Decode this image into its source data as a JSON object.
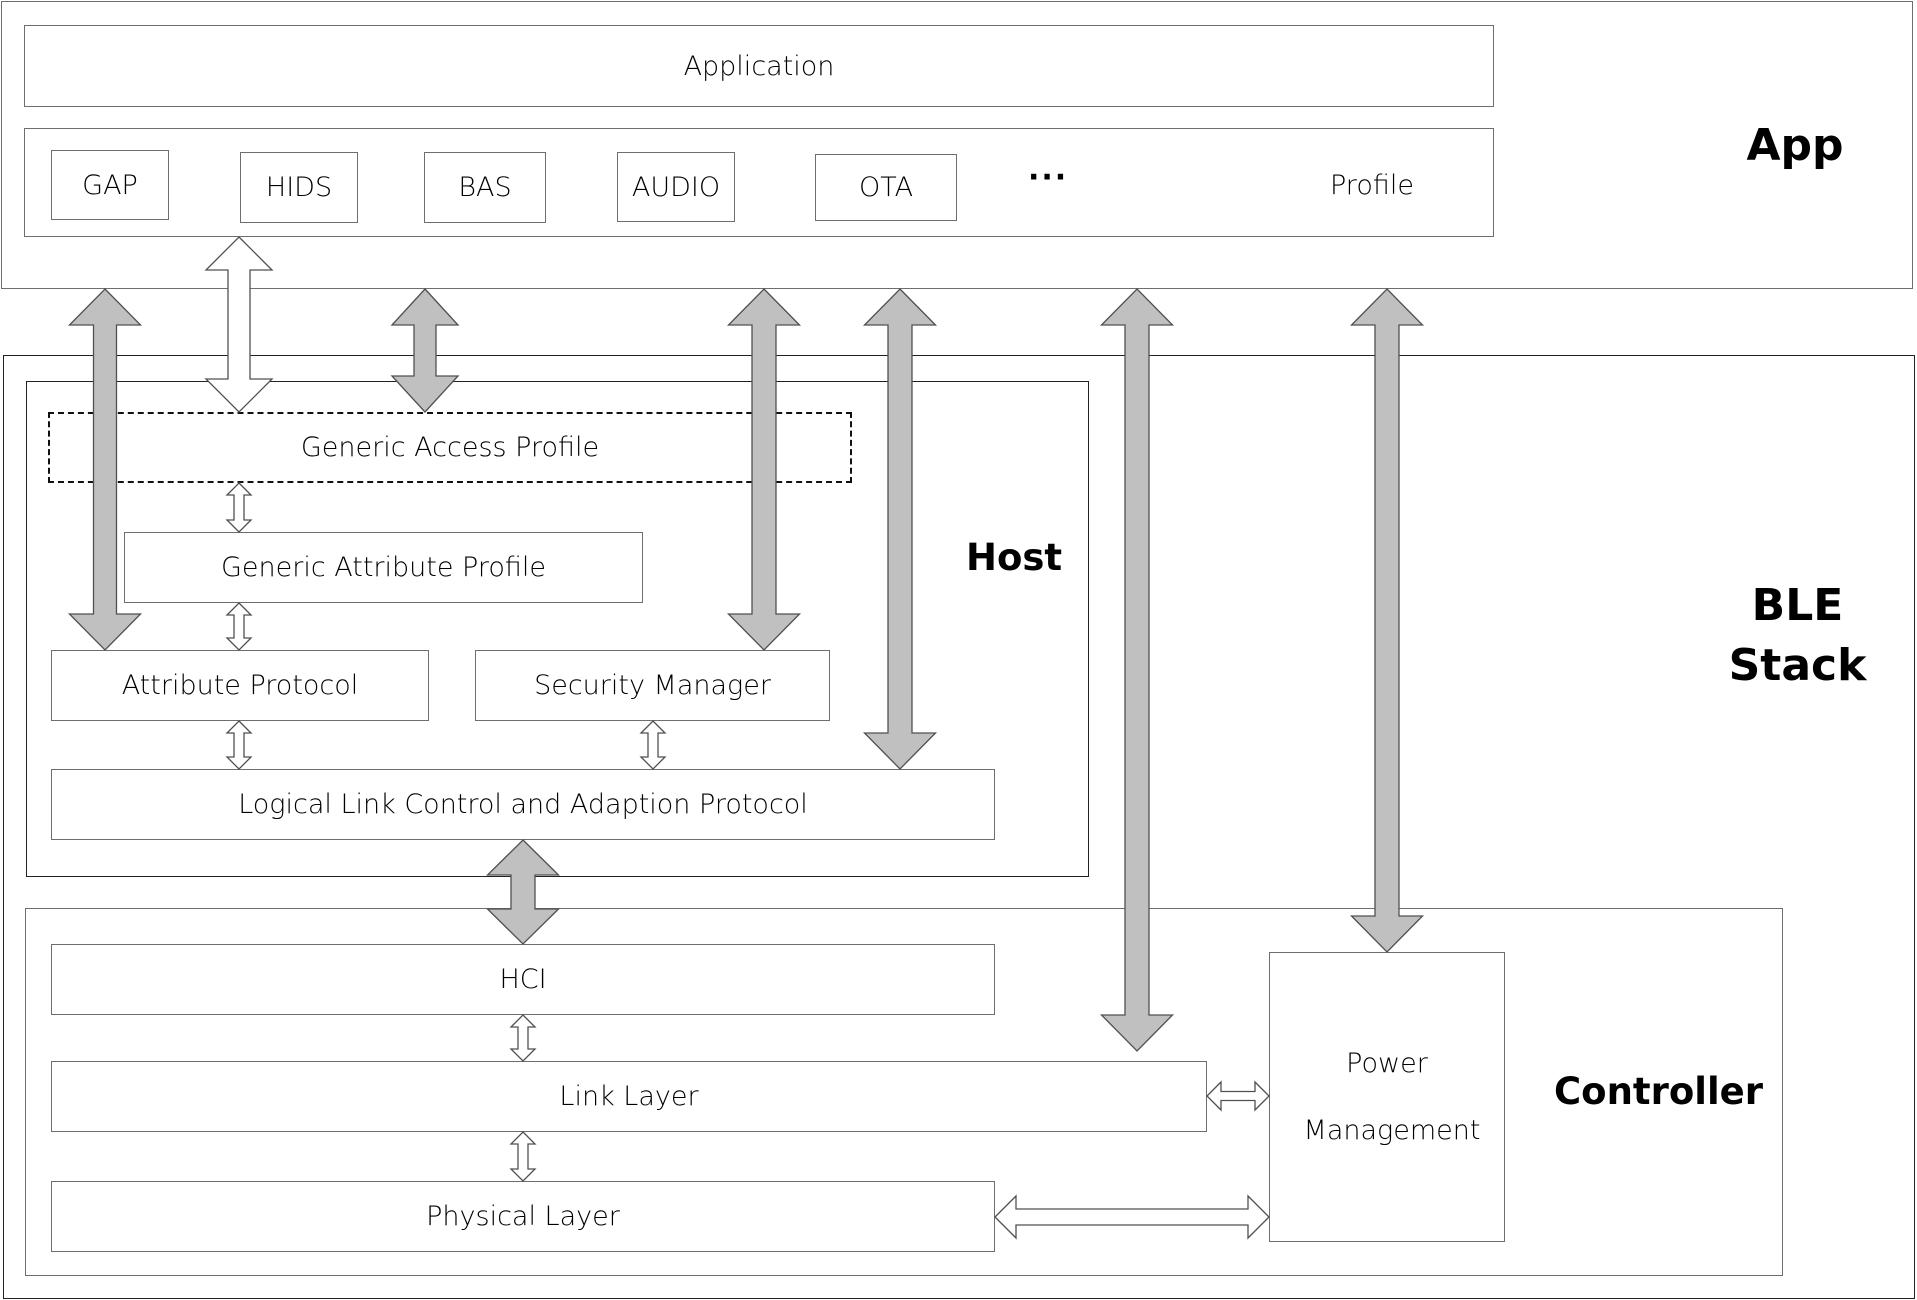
{
  "app_layer": {
    "label": "App",
    "application": "Application",
    "profile_label": "Profile",
    "profiles": [
      "GAP",
      "HIDS",
      "BAS",
      "AUDIO",
      "OTA"
    ],
    "more": "···"
  },
  "ble_stack": {
    "label_line1": "BLE",
    "label_line2": "Stack",
    "host": {
      "label": "Host",
      "gap": "Generic Access Profile",
      "gatt": "Generic Attribute Profile",
      "att": "Attribute Protocol",
      "sm": "Security Manager",
      "l2cap": "Logical Link Control and Adaption Protocol"
    },
    "controller": {
      "label": "Controller",
      "hci": "HCI",
      "link_layer": "Link Layer",
      "physical_layer": "Physical Layer",
      "power_line1": "Power",
      "power_line2": "Management"
    }
  },
  "colors": {
    "arrow_fill": "#c0c0c0",
    "hollow_arrow_fill": "#ffffff",
    "border": "#6e6e6e"
  }
}
